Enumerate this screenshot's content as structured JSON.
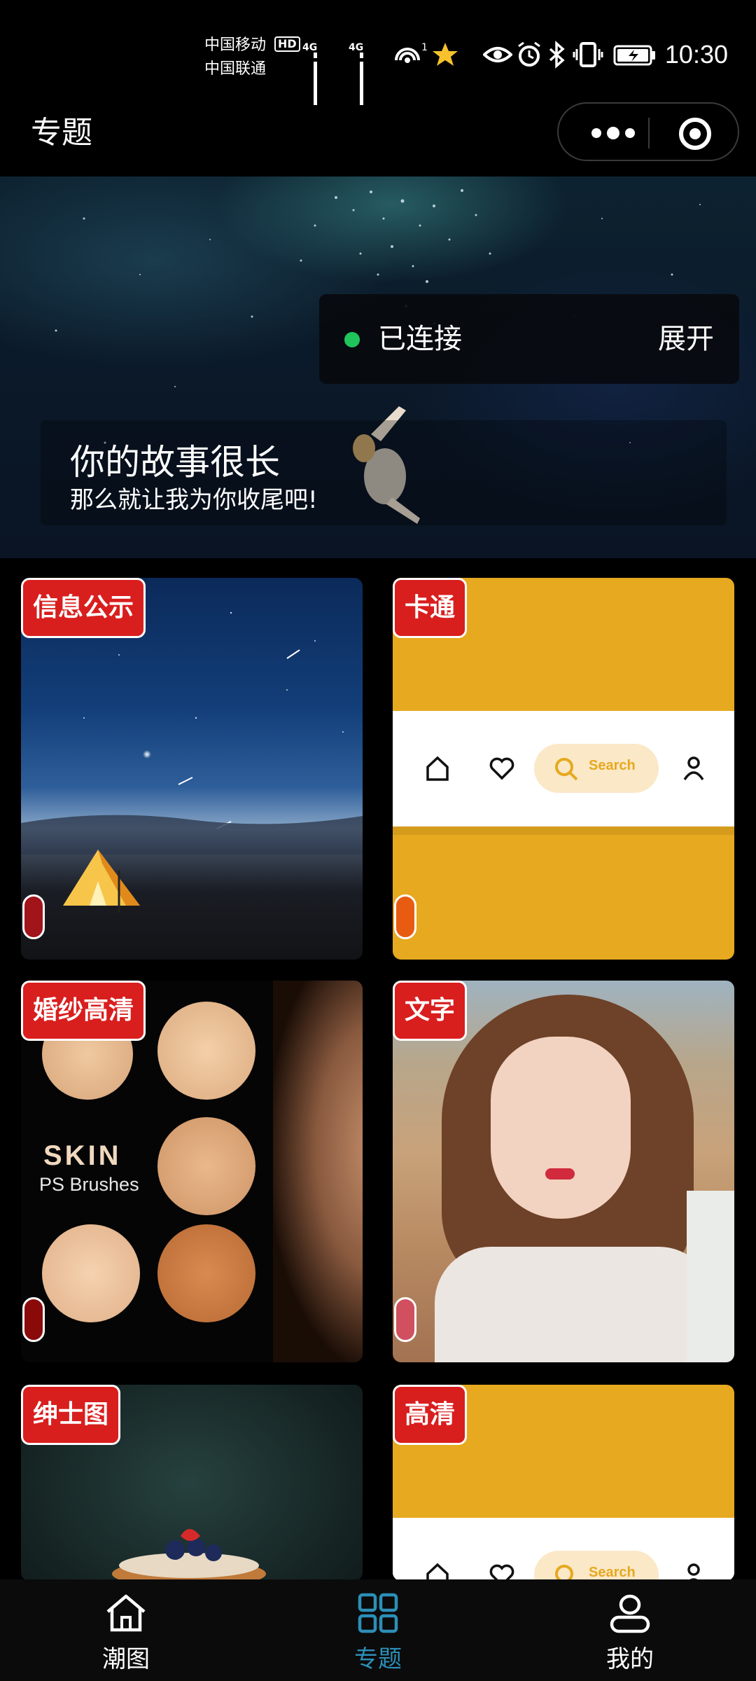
{
  "status_bar": {
    "carrier_1": "中国移动",
    "carrier_2": "中国联通",
    "hd": "HD",
    "network_1": "4G",
    "network_2": "4G",
    "hotspot_count": "1",
    "time": "10:30"
  },
  "nav": {
    "title": "专题"
  },
  "banner": {
    "connection_status": "已连接",
    "expand_label": "展开",
    "title": "你的故事很长",
    "subtitle": "那么就让我为你收尾吧!"
  },
  "cards": [
    {
      "tag": "信息公示",
      "pill_color": "#a0141a"
    },
    {
      "tag": "卡通",
      "pill_color": "#e85c12",
      "search_label": "Search"
    },
    {
      "tag": "婚纱高清",
      "pill_color": "#8a0a0a",
      "image_title": "SKIN",
      "image_subtitle": "PS Brushes"
    },
    {
      "tag": "文字",
      "pill_color": "#d05060"
    },
    {
      "tag": "绅士图"
    },
    {
      "tag": "高清",
      "search_label": "Search"
    }
  ],
  "tabbar": {
    "items": [
      {
        "label": "潮图",
        "active": false
      },
      {
        "label": "专题",
        "active": true
      },
      {
        "label": "我的",
        "active": false
      }
    ],
    "active_color": "#2c8fb8",
    "inactive_color": "#ffffff"
  },
  "colors": {
    "tag_red": "#d91e1e",
    "card_yellow": "#e6a91f",
    "connected_green": "#1fc55a"
  }
}
